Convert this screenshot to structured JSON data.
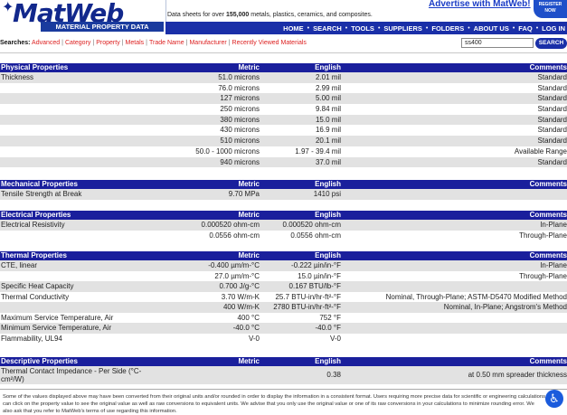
{
  "header": {
    "logo": "MatWeb",
    "logo_sub": "MATERIAL PROPERTY DATA",
    "tagline_pre": "Data sheets for over ",
    "tagline_count": "155,000",
    "tagline_post": " metals, plastics, ceramics, and composites.",
    "advertise": "Advertise with MatWeb!",
    "badge_line1": "REGISTER",
    "badge_line2": "NOW",
    "nav": [
      "HOME",
      "SEARCH",
      "TOOLS",
      "SUPPLIERS",
      "FOLDERS",
      "ABOUT US",
      "FAQ",
      "LOG IN"
    ]
  },
  "searchbar": {
    "label": "Searches:",
    "links": [
      "Advanced",
      "Category",
      "Property",
      "Metals",
      "Trade Name",
      "Manufacturer",
      "Recently Viewed Materials"
    ],
    "input_value": "ss400",
    "button": "SEARCH"
  },
  "columns": {
    "metric": "Metric",
    "english": "English",
    "comments": "Comments"
  },
  "physical": {
    "title": "Physical Properties",
    "rows": [
      {
        "name": "Thickness",
        "metric": "51.0 microns",
        "english": "2.01 mil",
        "comments": "Standard"
      },
      {
        "name": "",
        "metric": "76.0 microns",
        "english": "2.99 mil",
        "comments": "Standard"
      },
      {
        "name": "",
        "metric": "127 microns",
        "english": "5.00 mil",
        "comments": "Standard"
      },
      {
        "name": "",
        "metric": "250 microns",
        "english": "9.84 mil",
        "comments": "Standard"
      },
      {
        "name": "",
        "metric": "380 microns",
        "english": "15.0 mil",
        "comments": "Standard"
      },
      {
        "name": "",
        "metric": "430 microns",
        "english": "16.9 mil",
        "comments": "Standard"
      },
      {
        "name": "",
        "metric": "510 microns",
        "english": "20.1 mil",
        "comments": "Standard"
      },
      {
        "name": "",
        "metric": "50.0 - 1000 microns",
        "english": "1.97 - 39.4 mil",
        "comments": "Available Range"
      },
      {
        "name": "",
        "metric": "940 microns",
        "english": "37.0 mil",
        "comments": "Standard"
      }
    ]
  },
  "mechanical": {
    "title": "Mechanical Properties",
    "rows": [
      {
        "name": "Tensile Strength at Break",
        "metric": "9.70 MPa",
        "english": "1410 psi",
        "comments": ""
      }
    ]
  },
  "electrical": {
    "title": "Electrical Properties",
    "rows": [
      {
        "name": "Electrical Resistivity",
        "metric": "0.000520 ohm-cm",
        "english": "0.000520 ohm-cm",
        "comments": "In-Plane"
      },
      {
        "name": "",
        "metric": "0.0556 ohm-cm",
        "english": "0.0556 ohm-cm",
        "comments": "Through-Plane"
      }
    ]
  },
  "thermal": {
    "title": "Thermal Properties",
    "rows": [
      {
        "name": "CTE, linear",
        "metric": "-0.400 µm/m-°C",
        "english": "-0.222 µin/in-°F",
        "comments": "In-Plane"
      },
      {
        "name": "",
        "metric": "27.0 µm/m-°C",
        "english": "15.0 µin/in-°F",
        "comments": "Through-Plane"
      },
      {
        "name": "Specific Heat Capacity",
        "metric": "0.700 J/g-°C",
        "english": "0.167 BTU/lb-°F",
        "comments": ""
      },
      {
        "name": "Thermal Conductivity",
        "metric": "3.70 W/m-K",
        "english": "25.7 BTU-in/hr-ft²-°F",
        "comments": "Nominal, Through-Plane; ASTM-D5470 Modified Method"
      },
      {
        "name": "",
        "metric": "400 W/m-K",
        "english": "2780 BTU-in/hr-ft²-°F",
        "comments": "Nominal, In-Plane; Angstrom's Method"
      },
      {
        "name": "Maximum Service Temperature, Air",
        "metric": "400 °C",
        "english": "752 °F",
        "comments": ""
      },
      {
        "name": "Minimum Service Temperature, Air",
        "metric": "-40.0 °C",
        "english": "-40.0 °F",
        "comments": ""
      },
      {
        "name": "Flammability, UL94",
        "metric": "V-0",
        "english": "V-0",
        "comments": ""
      }
    ]
  },
  "descriptive": {
    "title": "Descriptive Properties",
    "rows": [
      {
        "name": "Thermal Contact Impedance - Per Side (°C-cm²/W)",
        "metric": "",
        "english": "0.38",
        "comments": "at 0.50 mm spreader thickness"
      }
    ]
  },
  "disclaimer": "Some of the values displayed above may have been converted from their original units and/or rounded in order to display the information in a consistent format. Users requiring more precise data for scientific or engineering calculations can click on the property value to see the original value as well as raw conversions to equivalent units. We advise that you only use the original value or one of its raw conversions in your calculations to minimize rounding error. We also ask that you refer to MatWeb's terms of use regarding this information."
}
